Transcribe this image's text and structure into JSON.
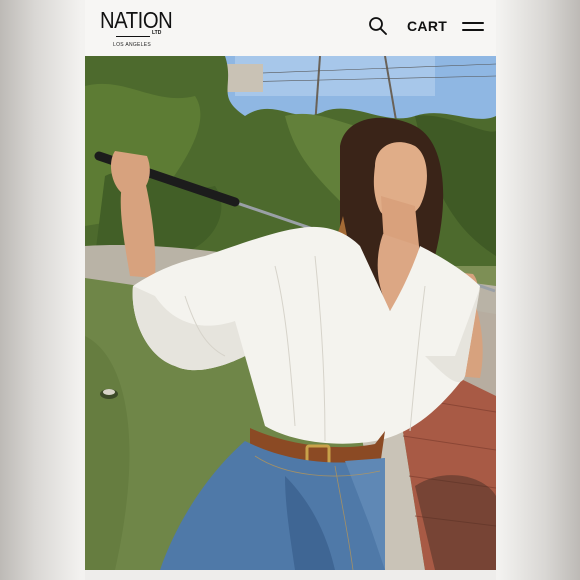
{
  "header": {
    "logo": {
      "wordmark": "NATION",
      "suffix": "LTD",
      "location": "LOS ANGELES"
    },
    "search_icon": "search-icon",
    "cart_label": "CART",
    "menu_icon": "hamburger-menu-icon"
  },
  "hero": {
    "alt": "Model in a white gauze peasant top and blue jeans holding a golf club on a mini golf course"
  },
  "colors": {
    "header_bg": "#f7f6f4",
    "text": "#111111",
    "sky": "#8fb7e3",
    "foliage": "#4d6a2d",
    "turf": "#6f8648",
    "blouse": "#f4f3ee",
    "denim": "#4f79a8",
    "brick": "#a85a45"
  }
}
